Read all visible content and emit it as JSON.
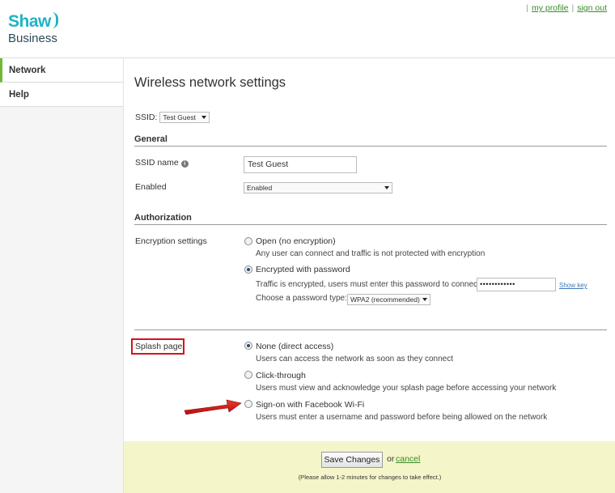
{
  "brand": {
    "name_top": "Shaw",
    "name_bottom": "Business",
    "accent": "#1fb4c6"
  },
  "toplinks": {
    "sep1": "|",
    "my_profile": "my profile",
    "sep2": "|",
    "sign_out": "sign out"
  },
  "sidebar": {
    "items": [
      {
        "label": "Network"
      },
      {
        "label": "Help"
      }
    ]
  },
  "page": {
    "title": "Wireless network settings"
  },
  "ssid_selector": {
    "label": "SSID:",
    "value": "Test Guest"
  },
  "general": {
    "heading": "General",
    "ssid_name_label": "SSID name",
    "ssid_name_value": "Test Guest",
    "enabled_label": "Enabled",
    "enabled_value": "Enabled"
  },
  "authorization": {
    "heading": "Authorization",
    "encryption_label": "Encryption settings",
    "open_label": "Open (no encryption)",
    "open_desc": "Any user can connect and traffic is not protected with encryption",
    "encrypted_label": "Encrypted with password",
    "encrypted_desc": "Traffic is encrypted, users must enter this password to connect:",
    "password_value": "••••••••••••",
    "show_key": "Show key",
    "password_type_label": "Choose a password type:",
    "password_type_value": "WPA2 (recommended)",
    "selected": "encrypted"
  },
  "splash": {
    "label": "Splash page",
    "none_label": "None (direct access)",
    "none_desc": "Users can access the network as soon as they connect",
    "click_label": "Click-through",
    "click_desc": "Users must view and acknowledge your splash page before accessing your network",
    "facebook_label": "Sign-on with Facebook Wi-Fi",
    "facebook_desc": "Users must enter a username and password before being allowed on the network",
    "selected": "none"
  },
  "footer": {
    "save_label": "Save Changes",
    "or_text": "or",
    "cancel_label": "cancel",
    "note": "(Please allow 1-2 minutes for changes to take effect.)",
    "background": "#f4f5c9"
  },
  "annotations": {
    "highlight_color": "#d4121a",
    "arrow_color": "#d4121a"
  }
}
